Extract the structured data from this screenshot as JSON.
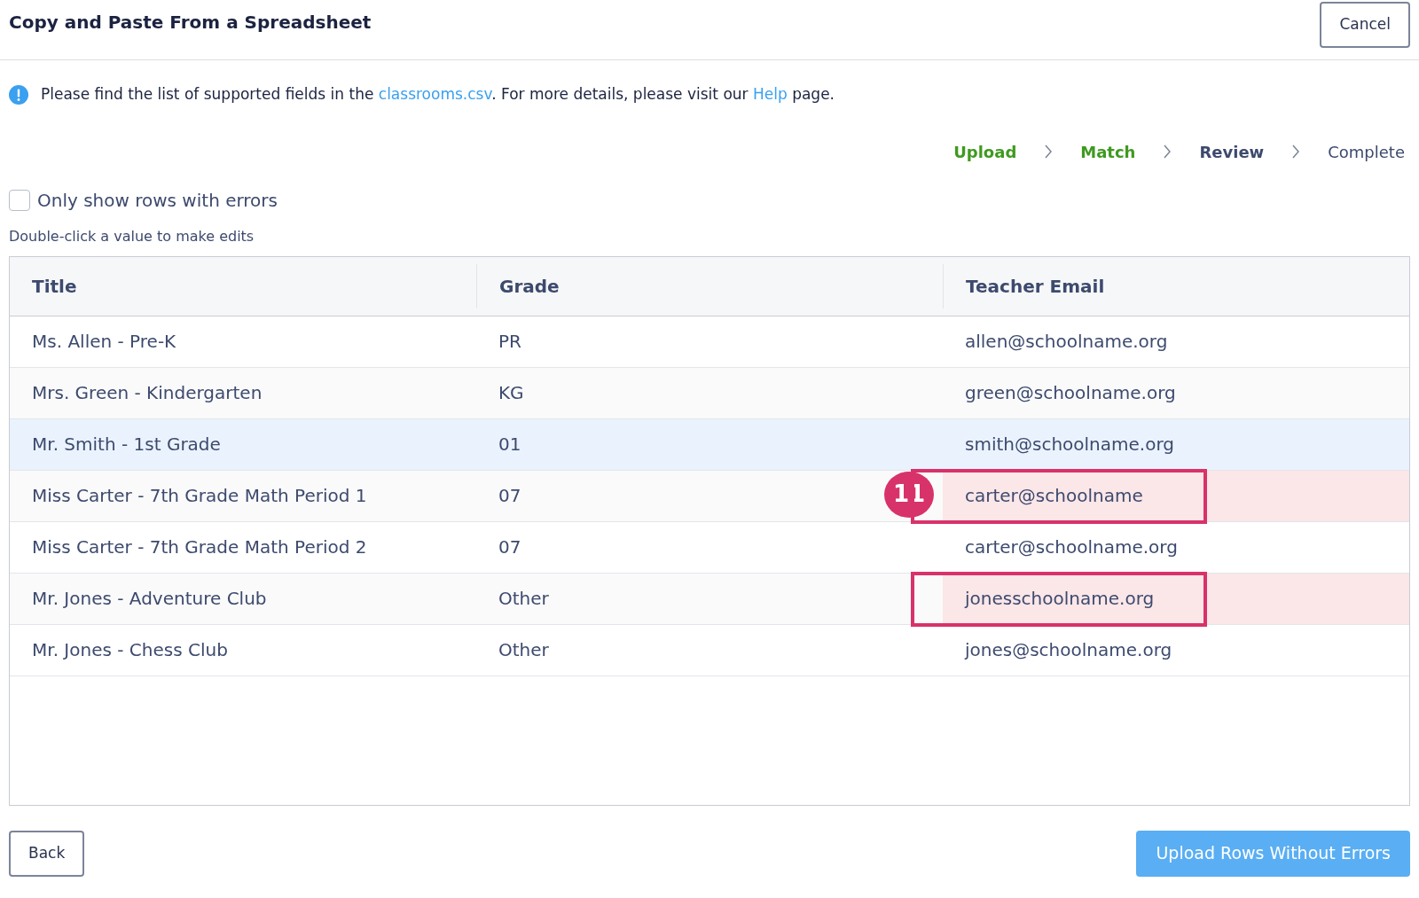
{
  "header": {
    "title": "Copy and Paste From a Spreadsheet",
    "cancel": "Cancel"
  },
  "info": {
    "text_before": "Please find the list of supported fields in the ",
    "link1": "classrooms.csv",
    "text_middle": ". For more details, please visit our ",
    "link2": "Help",
    "text_after": " page."
  },
  "steps": [
    {
      "label": "Upload",
      "completed": true,
      "selected": false
    },
    {
      "label": "Match",
      "completed": true,
      "selected": false
    },
    {
      "label": "Review",
      "completed": false,
      "selected": true
    },
    {
      "label": "Complete",
      "completed": false,
      "selected": false
    }
  ],
  "filter": {
    "label": "Only show rows with errors",
    "checked": false
  },
  "hint": "Double-click a value to make edits",
  "table": {
    "columns": [
      "Title",
      "Grade",
      "Teacher Email"
    ],
    "rows": [
      {
        "cells": [
          "Ms. Allen - Pre-K",
          "PR",
          "allen@schoolname.org"
        ],
        "selected": false,
        "email_error": false
      },
      {
        "cells": [
          "Mrs. Green - Kindergarten",
          "KG",
          "green@schoolname.org"
        ],
        "selected": false,
        "email_error": false
      },
      {
        "cells": [
          "Mr. Smith - 1st Grade",
          "01",
          "smith@schoolname.org"
        ],
        "selected": true,
        "email_error": false
      },
      {
        "cells": [
          "Miss Carter - 7th Grade Math Period 1",
          "07",
          "carter@schoolname"
        ],
        "selected": false,
        "email_error": true,
        "callout": "11"
      },
      {
        "cells": [
          "Miss Carter - 7th Grade Math Period 2",
          "07",
          "carter@schoolname.org"
        ],
        "selected": false,
        "email_error": false
      },
      {
        "cells": [
          "Mr. Jones - Adventure Club",
          "Other",
          "jonesschoolname.org"
        ],
        "selected": false,
        "email_error": true
      },
      {
        "cells": [
          "Mr. Jones - Chess Club",
          "Other",
          "jones@schoolname.org"
        ],
        "selected": false,
        "email_error": false
      }
    ]
  },
  "footer": {
    "back": "Back",
    "upload": "Upload Rows Without Errors"
  }
}
